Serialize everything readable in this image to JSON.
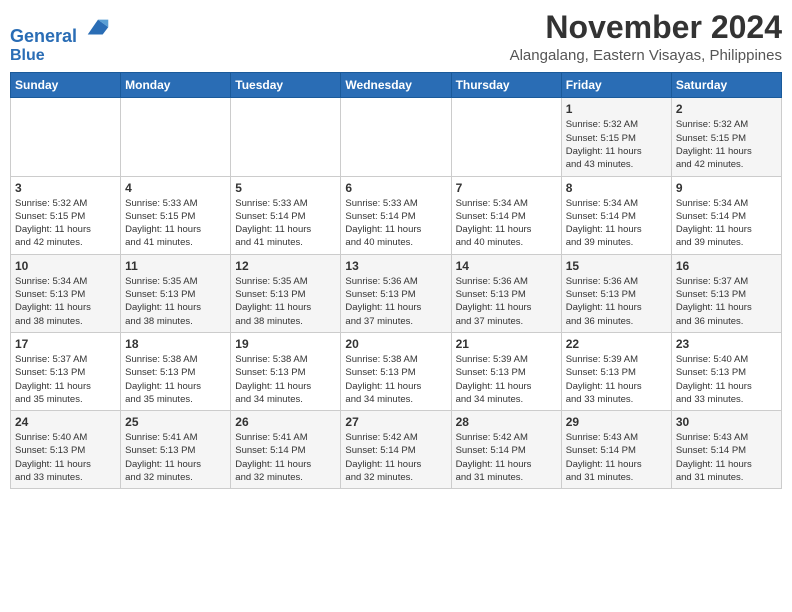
{
  "header": {
    "logo_line1": "General",
    "logo_line2": "Blue",
    "month": "November 2024",
    "location": "Alangalang, Eastern Visayas, Philippines"
  },
  "days_of_week": [
    "Sunday",
    "Monday",
    "Tuesday",
    "Wednesday",
    "Thursday",
    "Friday",
    "Saturday"
  ],
  "weeks": [
    [
      {
        "day": "",
        "info": ""
      },
      {
        "day": "",
        "info": ""
      },
      {
        "day": "",
        "info": ""
      },
      {
        "day": "",
        "info": ""
      },
      {
        "day": "",
        "info": ""
      },
      {
        "day": "1",
        "info": "Sunrise: 5:32 AM\nSunset: 5:15 PM\nDaylight: 11 hours\nand 43 minutes."
      },
      {
        "day": "2",
        "info": "Sunrise: 5:32 AM\nSunset: 5:15 PM\nDaylight: 11 hours\nand 42 minutes."
      }
    ],
    [
      {
        "day": "3",
        "info": "Sunrise: 5:32 AM\nSunset: 5:15 PM\nDaylight: 11 hours\nand 42 minutes."
      },
      {
        "day": "4",
        "info": "Sunrise: 5:33 AM\nSunset: 5:15 PM\nDaylight: 11 hours\nand 41 minutes."
      },
      {
        "day": "5",
        "info": "Sunrise: 5:33 AM\nSunset: 5:14 PM\nDaylight: 11 hours\nand 41 minutes."
      },
      {
        "day": "6",
        "info": "Sunrise: 5:33 AM\nSunset: 5:14 PM\nDaylight: 11 hours\nand 40 minutes."
      },
      {
        "day": "7",
        "info": "Sunrise: 5:34 AM\nSunset: 5:14 PM\nDaylight: 11 hours\nand 40 minutes."
      },
      {
        "day": "8",
        "info": "Sunrise: 5:34 AM\nSunset: 5:14 PM\nDaylight: 11 hours\nand 39 minutes."
      },
      {
        "day": "9",
        "info": "Sunrise: 5:34 AM\nSunset: 5:14 PM\nDaylight: 11 hours\nand 39 minutes."
      }
    ],
    [
      {
        "day": "10",
        "info": "Sunrise: 5:34 AM\nSunset: 5:13 PM\nDaylight: 11 hours\nand 38 minutes."
      },
      {
        "day": "11",
        "info": "Sunrise: 5:35 AM\nSunset: 5:13 PM\nDaylight: 11 hours\nand 38 minutes."
      },
      {
        "day": "12",
        "info": "Sunrise: 5:35 AM\nSunset: 5:13 PM\nDaylight: 11 hours\nand 38 minutes."
      },
      {
        "day": "13",
        "info": "Sunrise: 5:36 AM\nSunset: 5:13 PM\nDaylight: 11 hours\nand 37 minutes."
      },
      {
        "day": "14",
        "info": "Sunrise: 5:36 AM\nSunset: 5:13 PM\nDaylight: 11 hours\nand 37 minutes."
      },
      {
        "day": "15",
        "info": "Sunrise: 5:36 AM\nSunset: 5:13 PM\nDaylight: 11 hours\nand 36 minutes."
      },
      {
        "day": "16",
        "info": "Sunrise: 5:37 AM\nSunset: 5:13 PM\nDaylight: 11 hours\nand 36 minutes."
      }
    ],
    [
      {
        "day": "17",
        "info": "Sunrise: 5:37 AM\nSunset: 5:13 PM\nDaylight: 11 hours\nand 35 minutes."
      },
      {
        "day": "18",
        "info": "Sunrise: 5:38 AM\nSunset: 5:13 PM\nDaylight: 11 hours\nand 35 minutes."
      },
      {
        "day": "19",
        "info": "Sunrise: 5:38 AM\nSunset: 5:13 PM\nDaylight: 11 hours\nand 34 minutes."
      },
      {
        "day": "20",
        "info": "Sunrise: 5:38 AM\nSunset: 5:13 PM\nDaylight: 11 hours\nand 34 minutes."
      },
      {
        "day": "21",
        "info": "Sunrise: 5:39 AM\nSunset: 5:13 PM\nDaylight: 11 hours\nand 34 minutes."
      },
      {
        "day": "22",
        "info": "Sunrise: 5:39 AM\nSunset: 5:13 PM\nDaylight: 11 hours\nand 33 minutes."
      },
      {
        "day": "23",
        "info": "Sunrise: 5:40 AM\nSunset: 5:13 PM\nDaylight: 11 hours\nand 33 minutes."
      }
    ],
    [
      {
        "day": "24",
        "info": "Sunrise: 5:40 AM\nSunset: 5:13 PM\nDaylight: 11 hours\nand 33 minutes."
      },
      {
        "day": "25",
        "info": "Sunrise: 5:41 AM\nSunset: 5:13 PM\nDaylight: 11 hours\nand 32 minutes."
      },
      {
        "day": "26",
        "info": "Sunrise: 5:41 AM\nSunset: 5:14 PM\nDaylight: 11 hours\nand 32 minutes."
      },
      {
        "day": "27",
        "info": "Sunrise: 5:42 AM\nSunset: 5:14 PM\nDaylight: 11 hours\nand 32 minutes."
      },
      {
        "day": "28",
        "info": "Sunrise: 5:42 AM\nSunset: 5:14 PM\nDaylight: 11 hours\nand 31 minutes."
      },
      {
        "day": "29",
        "info": "Sunrise: 5:43 AM\nSunset: 5:14 PM\nDaylight: 11 hours\nand 31 minutes."
      },
      {
        "day": "30",
        "info": "Sunrise: 5:43 AM\nSunset: 5:14 PM\nDaylight: 11 hours\nand 31 minutes."
      }
    ]
  ]
}
